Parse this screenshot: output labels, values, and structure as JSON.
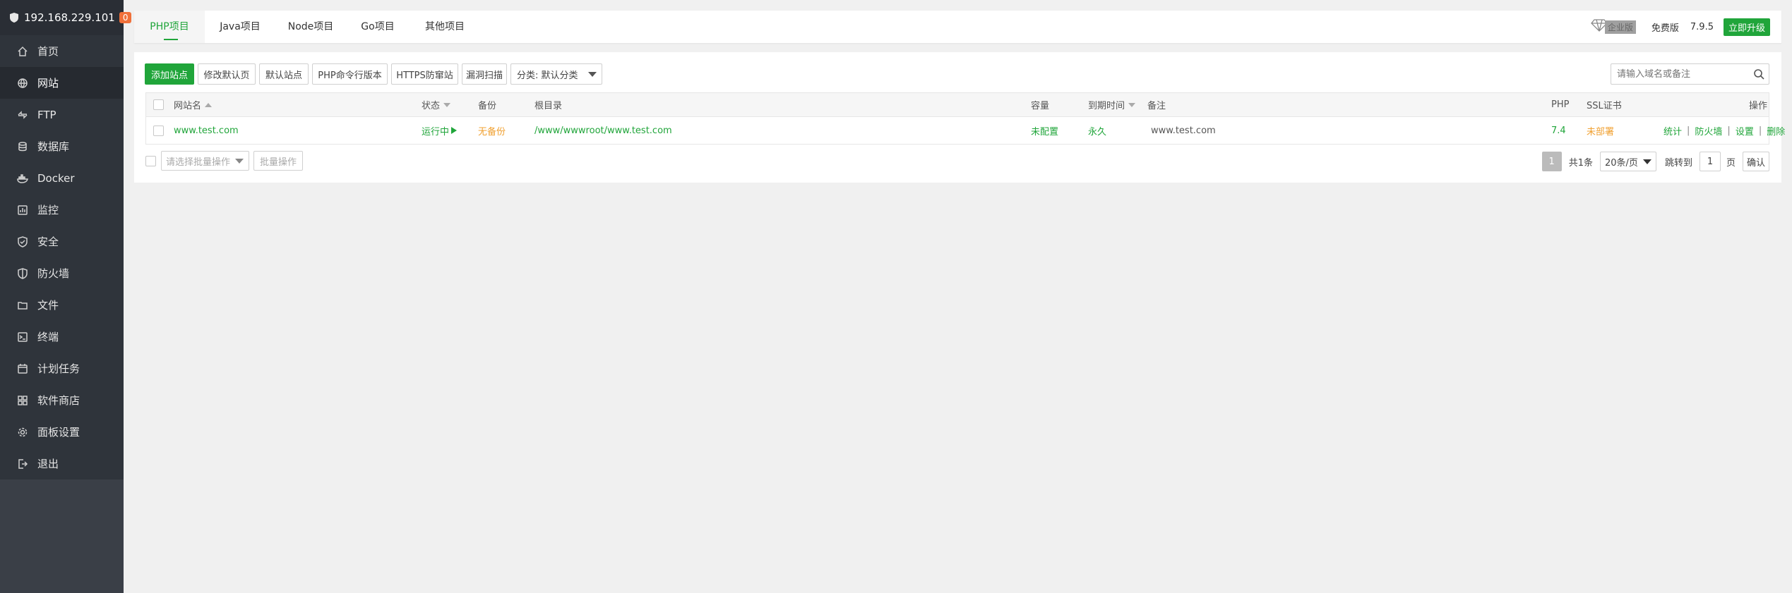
{
  "sidebar": {
    "ip": "192.168.229.101",
    "badge": "0",
    "items": [
      {
        "label": "首页",
        "icon": "home-icon"
      },
      {
        "label": "网站",
        "icon": "globe-icon",
        "active": true
      },
      {
        "label": "FTP",
        "icon": "ftp-icon"
      },
      {
        "label": "数据库",
        "icon": "database-icon"
      },
      {
        "label": "Docker",
        "icon": "docker-icon"
      },
      {
        "label": "监控",
        "icon": "monitor-icon"
      },
      {
        "label": "安全",
        "icon": "shield-icon"
      },
      {
        "label": "防火墙",
        "icon": "firewall-icon"
      },
      {
        "label": "文件",
        "icon": "folder-icon"
      },
      {
        "label": "终端",
        "icon": "terminal-icon"
      },
      {
        "label": "计划任务",
        "icon": "calendar-icon"
      },
      {
        "label": "软件商店",
        "icon": "apps-icon"
      },
      {
        "label": "面板设置",
        "icon": "gear-icon"
      },
      {
        "label": "退出",
        "icon": "logout-icon"
      }
    ]
  },
  "tabs": [
    {
      "label": "PHP项目",
      "active": true
    },
    {
      "label": "Java项目"
    },
    {
      "label": "Node项目"
    },
    {
      "label": "Go项目"
    },
    {
      "label": "其他项目"
    }
  ],
  "top_right": {
    "enterprise": "企业版",
    "free": "免费版",
    "version": "7.9.5",
    "upgrade": "立即升级"
  },
  "toolbar": {
    "add_site": "添加站点",
    "edit_default_page": "修改默认页",
    "default_site": "默认站点",
    "php_cli_version": "PHP命令行版本",
    "https_protection": "HTTPS防窜站",
    "vuln_scan": "漏洞扫描",
    "category": "分类: 默认分类",
    "search_placeholder": "请输入域名或备注"
  },
  "table": {
    "headers": {
      "site_name": "网站名",
      "status": "状态",
      "backup": "备份",
      "root_dir": "根目录",
      "capacity": "容量",
      "expire": "到期时间",
      "remark": "备注",
      "php": "PHP",
      "ssl": "SSL证书",
      "actions": "操作"
    },
    "rows": [
      {
        "site_name": "www.test.com",
        "status": "运行中",
        "backup": "无备份",
        "root_dir": "/www/wwwroot/www.test.com",
        "capacity": "未配置",
        "expire": "永久",
        "remark": "www.test.com",
        "php": "7.4",
        "ssl": "未部署",
        "actions": [
          "统计",
          "防火墙",
          "设置",
          "删除"
        ]
      }
    ]
  },
  "footer": {
    "batch_select": "请选择批量操作",
    "batch_btn": "批量操作",
    "current_page": "1",
    "total": "共1条",
    "per_page": "20条/页",
    "jump_to": "跳转到",
    "jump_value": "1",
    "page_unit": "页",
    "confirm": "确认"
  },
  "colors": {
    "accent": "#20a53a",
    "warning": "#f0a030",
    "sidebar_bg": "#3a3f47",
    "badge": "#f0703a"
  }
}
